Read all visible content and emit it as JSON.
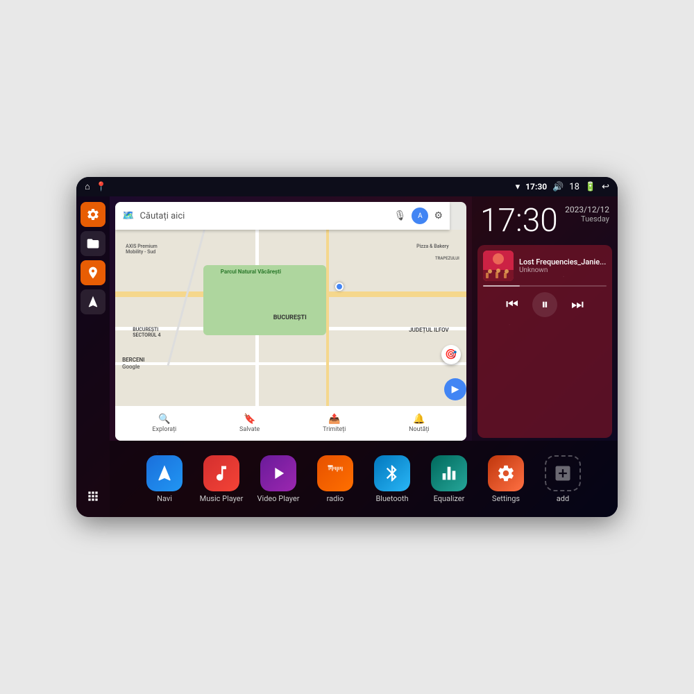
{
  "device": {
    "statusBar": {
      "time": "17:30",
      "wifiIcon": "wifi-icon",
      "batteryIcon": "battery-icon",
      "volumeIcon": "volume-icon",
      "batteryLevel": "18",
      "backIcon": "back-icon",
      "homeIcon": "home-icon",
      "mapsIcon": "maps-icon"
    },
    "clock": {
      "time": "17:30",
      "date": "2023/12/12",
      "day": "Tuesday"
    },
    "music": {
      "title": "Lost Frequencies_Janie...",
      "artist": "Unknown",
      "albumArt": "🎵"
    },
    "map": {
      "searchPlaceholder": "Căutați aici",
      "labels": [
        "Parcul Natural Văcărești",
        "BUCUREȘTI",
        "JUDEȚUL ILFOV",
        "BERCENI",
        "BUCUREȘTI SECTORUL 4",
        "AXIS Premium Mobility - Sud",
        "Pizza & Bakery",
        "TRAPEZULUI"
      ],
      "bottomItems": [
        "Explorați",
        "Salvate",
        "Trimiteți",
        "Noutăți"
      ]
    },
    "apps": [
      {
        "id": "navi",
        "label": "Navi",
        "iconClass": "blue-grad",
        "icon": "navi"
      },
      {
        "id": "music-player",
        "label": "Music Player",
        "iconClass": "red-grad",
        "icon": "music"
      },
      {
        "id": "video-player",
        "label": "Video Player",
        "iconClass": "purple-grad",
        "icon": "video"
      },
      {
        "id": "radio",
        "label": "radio",
        "iconClass": "orange-grad",
        "icon": "radio"
      },
      {
        "id": "bluetooth",
        "label": "Bluetooth",
        "iconClass": "blue2-grad",
        "icon": "bluetooth"
      },
      {
        "id": "equalizer",
        "label": "Equalizer",
        "iconClass": "teal-grad",
        "icon": "equalizer"
      },
      {
        "id": "settings",
        "label": "Settings",
        "iconClass": "orange2-grad",
        "icon": "settings"
      },
      {
        "id": "add",
        "label": "add",
        "iconClass": "dotted",
        "icon": "add"
      }
    ]
  }
}
